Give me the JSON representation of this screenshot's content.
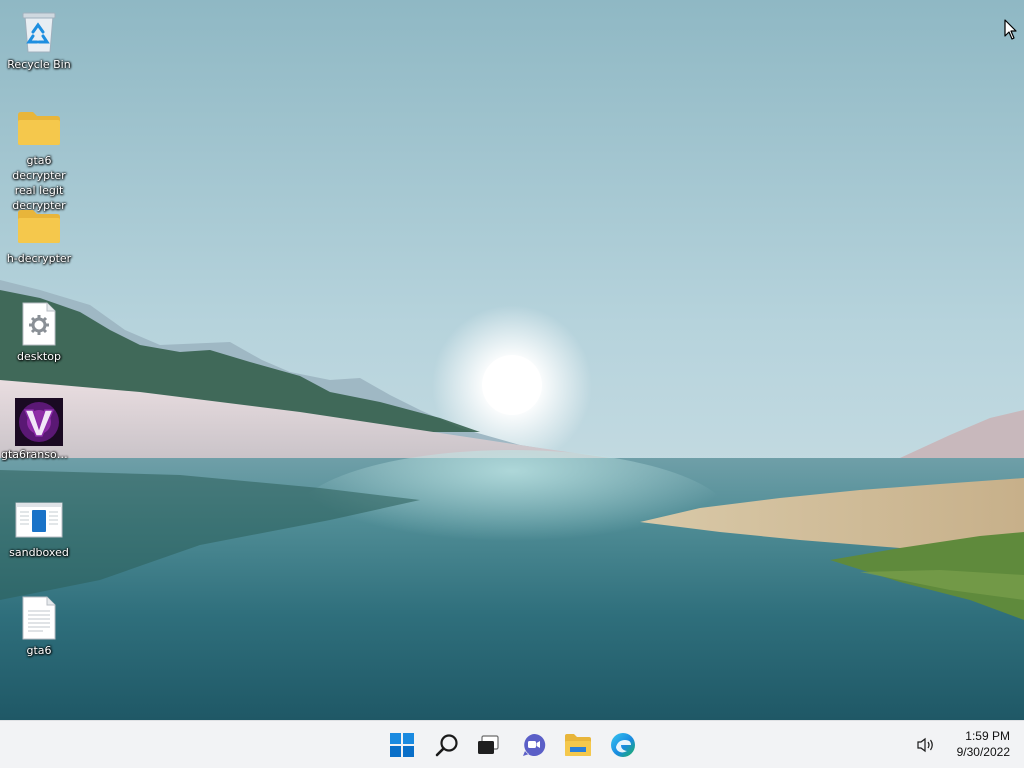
{
  "desktop": {
    "icons": [
      {
        "id": "recycle-bin",
        "label": "Recycle Bin",
        "icon": "recycle-bin-icon"
      },
      {
        "id": "folder-gta6-decrypter",
        "label": "gta6 decrypter real legit decrypter",
        "icon": "folder-icon"
      },
      {
        "id": "folder-h-decrypter",
        "label": "h-decrypter",
        "icon": "folder-icon"
      },
      {
        "id": "desktop-file",
        "label": "desktop",
        "icon": "settings-file-icon"
      },
      {
        "id": "gta6ransom",
        "label": "gta6ransom...",
        "icon": "app-v-icon"
      },
      {
        "id": "sandboxed",
        "label": "sandboxed",
        "icon": "window-app-icon"
      },
      {
        "id": "gta6-text",
        "label": "gta6",
        "icon": "text-file-icon"
      }
    ]
  },
  "taskbar": {
    "apps": [
      {
        "name": "start-button",
        "icon": "windows-logo-icon"
      },
      {
        "name": "search-button",
        "icon": "search-icon"
      },
      {
        "name": "task-view-button",
        "icon": "task-view-icon"
      },
      {
        "name": "chat-button",
        "icon": "chat-icon"
      },
      {
        "name": "file-explorer-button",
        "icon": "folder-icon"
      },
      {
        "name": "edge-button",
        "icon": "edge-icon"
      }
    ],
    "tray": {
      "volume_icon": "speaker-icon",
      "time": "1:59 PM",
      "date": "9/30/2022"
    }
  },
  "colors": {
    "taskbar_bg": "#f2f3f5",
    "accent": "#0067c0",
    "folder": "#f5c84c"
  }
}
